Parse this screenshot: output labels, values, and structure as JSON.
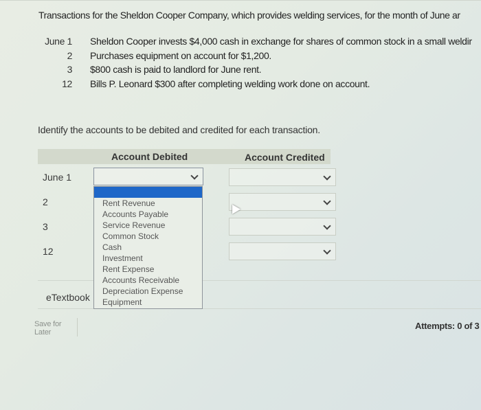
{
  "intro": "Transactions for the Sheldon Cooper Company, which provides welding services, for the month of June ar",
  "transactions": [
    {
      "date": "June 1",
      "desc": "Sheldon Cooper invests $4,000 cash in exchange for shares of common stock in a small weldir"
    },
    {
      "date": "2",
      "desc": "Purchases equipment on account for $1,200."
    },
    {
      "date": "3",
      "desc": "$800 cash is paid to landlord for June rent."
    },
    {
      "date": "12",
      "desc": "Bills P. Leonard $300 after completing welding work done on account."
    }
  ],
  "instruction": "Identify the accounts to be debited and credited for each transaction.",
  "table": {
    "header_debited": "Account Debited",
    "header_credited": "Account Credited",
    "rows": [
      {
        "label": "June 1",
        "debit": "",
        "credit": ""
      },
      {
        "label": "2",
        "debit": "",
        "credit": ""
      },
      {
        "label": "3",
        "debit": "",
        "credit": ""
      },
      {
        "label": "12",
        "debit": "",
        "credit": ""
      }
    ]
  },
  "dropdown": {
    "selected": "",
    "options": [
      "Rent Revenue",
      "Accounts Payable",
      "Service Revenue",
      "Common Stock",
      "Cash",
      "Investment",
      "Rent Expense",
      "Accounts Receivable",
      "Depreciation Expense",
      "Equipment"
    ]
  },
  "etextbook_label": "eTextbook",
  "save_for_later": "Save for Later",
  "attempts": "Attempts: 0 of 3",
  "colors": {
    "highlight": "#1e67c8"
  }
}
